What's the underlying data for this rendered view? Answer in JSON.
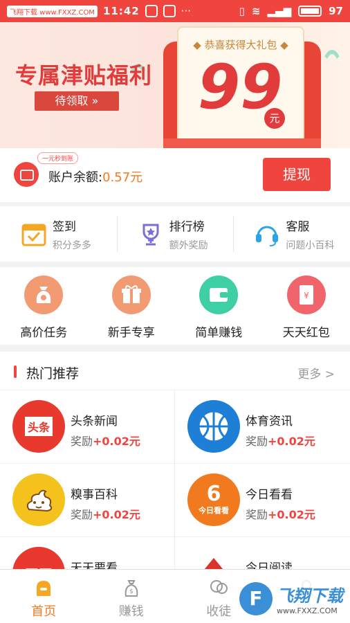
{
  "status_bar": {
    "watermark": "飞翔下载 www.FXXZ.COM",
    "time": "11:42",
    "battery": "97"
  },
  "banner": {
    "title": "专属津贴福利",
    "button": "待领取 »",
    "card_title": "◆ 恭喜获得大礼包 ◆",
    "amount": "99",
    "unit": "元"
  },
  "balance": {
    "tag": "一元秒到账",
    "label": "账户余额:",
    "value": "0.57元",
    "withdraw": "提现"
  },
  "features": [
    {
      "title": "签到",
      "sub": "积分多多",
      "icon": "calendar-check-icon"
    },
    {
      "title": "排行榜",
      "sub": "额外奖励",
      "icon": "trophy-icon"
    },
    {
      "title": "客服",
      "sub": "问题小百科",
      "icon": "headset-icon"
    }
  ],
  "quick": [
    {
      "label": "高价任务",
      "icon": "money-bag-icon",
      "color": "#f29a72"
    },
    {
      "label": "新手专享",
      "icon": "gift-icon",
      "color": "#f29a72"
    },
    {
      "label": "简单赚钱",
      "icon": "wallet-icon",
      "color": "#3fcfa4"
    },
    {
      "label": "天天红包",
      "icon": "red-envelope-icon",
      "color": "#f0656b"
    }
  ],
  "hot": {
    "title": "热门推荐",
    "more": "更多 >"
  },
  "apps": [
    {
      "name": "头条新闻",
      "reward_label": "奖励",
      "reward": "+0.02元",
      "logo_text": "头条",
      "color": "#e8392f"
    },
    {
      "name": "体育资讯",
      "reward_label": "奖励",
      "reward": "+0.02元",
      "logo_text": "",
      "color": "#1e7fd6"
    },
    {
      "name": "糗事百科",
      "reward_label": "奖励",
      "reward": "+0.02元",
      "logo_text": "",
      "color": "#f5c11c"
    },
    {
      "name": "今日看看",
      "reward_label": "奖励",
      "reward": "+0.02元",
      "logo_text": "今日看看",
      "color": "#f07a1d"
    },
    {
      "name": "天天要看",
      "reward_label": "",
      "reward": "",
      "logo_text": "天天",
      "color": "#e8392f"
    },
    {
      "name": "今日阅读",
      "reward_label": "",
      "reward": "",
      "logo_text": "",
      "color": "#d9332b"
    }
  ],
  "nav": [
    {
      "label": "首页",
      "icon": "home-icon",
      "active": true
    },
    {
      "label": "赚钱",
      "icon": "money-bag-icon",
      "active": false
    },
    {
      "label": "收徒",
      "icon": "apprentice-icon",
      "active": false
    },
    {
      "label": "",
      "icon": "profile-icon",
      "active": false
    }
  ],
  "watermark": {
    "title": "飞翔下载",
    "url": "www.FXXZ.COM"
  }
}
